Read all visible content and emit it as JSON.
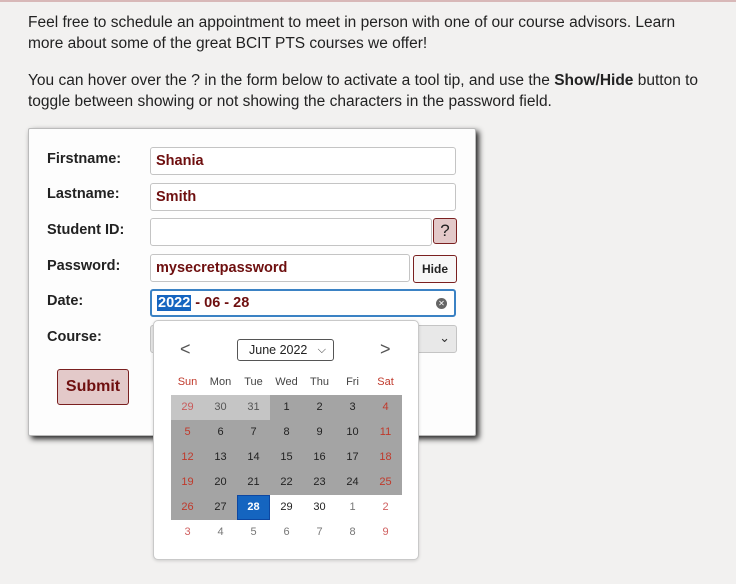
{
  "intro": {
    "p1": "Feel free to schedule an appointment to meet in person with one of our course advisors. Learn more about some of the great BCIT PTS courses we offer!",
    "p2_before": "You can hover over the ",
    "p2_icon": "?",
    "p2_mid": " in the form below to activate a tool tip, and use the ",
    "p2_bold": "Show/Hide",
    "p2_after": " button to toggle between showing or not showing the characters in the password field."
  },
  "form": {
    "firstname_label": "Firstname:",
    "firstname_value": "Shania",
    "lastname_label": "Lastname:",
    "lastname_value": "Smith",
    "studentid_label": "Student ID:",
    "studentid_value": "",
    "help_icon": "?",
    "password_label": "Password:",
    "password_value": "mysecretpassword",
    "hide_label": "Hide",
    "date_label": "Date:",
    "date_year": "2022",
    "date_rest": " - 06 - 28",
    "clear_icon": "✕",
    "course_label": "Course:",
    "submit_label": "Submit"
  },
  "calendar": {
    "prev_icon": "<",
    "next_icon": ">",
    "month_label": "June 2022",
    "weekdays": [
      "Sun",
      "Mon",
      "Tue",
      "Wed",
      "Thu",
      "Fri",
      "Sat"
    ],
    "days": [
      [
        "29",
        "30",
        "31",
        "1",
        "2",
        "3",
        "4"
      ],
      [
        "5",
        "6",
        "7",
        "8",
        "9",
        "10",
        "11"
      ],
      [
        "12",
        "13",
        "14",
        "15",
        "16",
        "17",
        "18"
      ],
      [
        "19",
        "20",
        "21",
        "22",
        "23",
        "24",
        "25"
      ],
      [
        "26",
        "27",
        "28",
        "29",
        "30",
        "1",
        "2"
      ],
      [
        "3",
        "4",
        "5",
        "6",
        "7",
        "8",
        "9"
      ]
    ],
    "selected_day": "28"
  }
}
